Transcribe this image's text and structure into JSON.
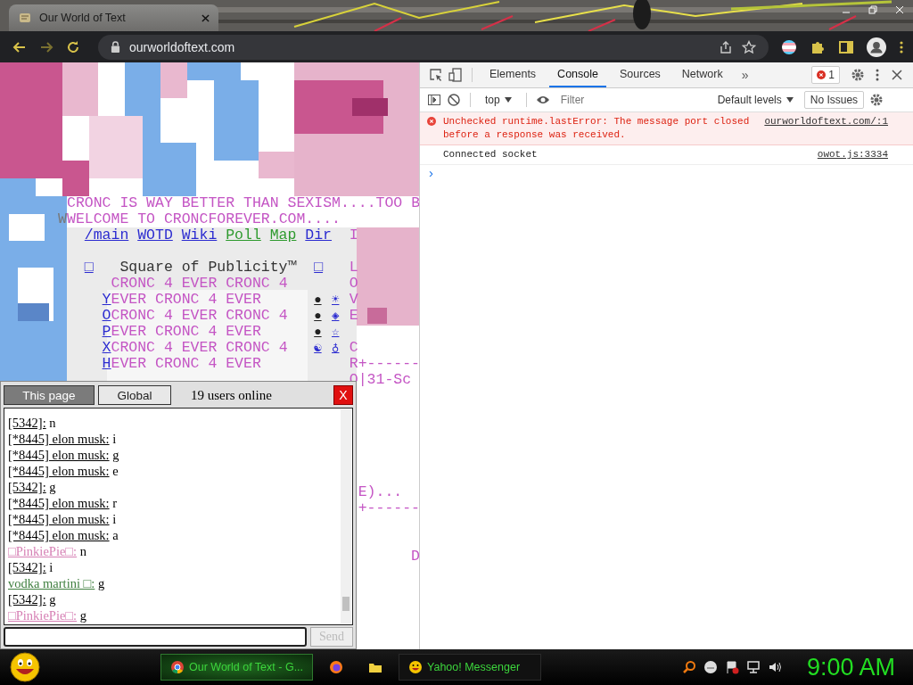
{
  "browser": {
    "tab_title": "Our World of Text",
    "url": "ourworldoftext.com"
  },
  "canvas": {
    "banner": "CRONC IS WAY BETTER THAN SEXISM....TOO B",
    "welcome_mark": "W",
    "welcome": "WELCOME TO CRONCFOREVER.COM....",
    "nav_links": [
      {
        "text": "/main",
        "color": "#2b2bd0"
      },
      {
        "text": "WOTD",
        "color": "#2b2bd0"
      },
      {
        "text": "Wiki",
        "color": "#2b2bd0"
      },
      {
        "text": "Poll",
        "color": "#2e9a2e"
      },
      {
        "text": "Map",
        "color": "#2e9a2e"
      },
      {
        "text": "Dir",
        "color": "#2b2bd0"
      }
    ],
    "title_marks": [
      "□",
      "□"
    ],
    "publicity_title": "Square of Publicity™",
    "rows": [
      {
        "letter": "",
        "text": "CRONC 4 EVER CRONC 4",
        "icons": []
      },
      {
        "letter": "Y",
        "text": "EVER CRONC 4 EVER",
        "icons": [
          "●",
          "☀"
        ]
      },
      {
        "letter": "O",
        "text": "CRONC 4 EVER CRONC 4",
        "icons": [
          "●",
          "◈"
        ]
      },
      {
        "letter": "P",
        "text": "EVER CRONC 4 EVER",
        "icons": [
          "●",
          "☆"
        ]
      },
      {
        "letter": "X",
        "text": "CRONC 4 EVER CRONC 4",
        "icons": [
          "☯",
          "♁"
        ]
      },
      {
        "letter": "H",
        "text": "EVER CRONC 4 EVER",
        "icons": []
      }
    ],
    "right_column": [
      "I",
      "L",
      "O",
      "V",
      "E",
      "C",
      "R+------",
      "O|31-Sc"
    ],
    "fragments": [
      "E)...",
      "+------",
      "D"
    ]
  },
  "chat": {
    "tabs": [
      {
        "label": "This page",
        "selected": true
      },
      {
        "label": "Global",
        "selected": false
      }
    ],
    "online": "19 users online",
    "close": "X",
    "messages": [
      {
        "name": "[5342]:",
        "text": "n",
        "color": "#000000"
      },
      {
        "name": "[*8445] elon musk:",
        "text": "i",
        "color": "#000000"
      },
      {
        "name": "[*8445] elon musk:",
        "text": "g",
        "color": "#000000"
      },
      {
        "name": "[*8445] elon musk:",
        "text": "e",
        "color": "#000000"
      },
      {
        "name": "[5342]:",
        "text": "g",
        "color": "#000000"
      },
      {
        "name": "[*8445] elon musk:",
        "text": "r",
        "color": "#000000"
      },
      {
        "name": "[*8445] elon musk:",
        "text": "i",
        "color": "#000000"
      },
      {
        "name": "[*8445] elon musk:",
        "text": "a",
        "color": "#000000"
      },
      {
        "name": "□PinkiePie□:",
        "text": "n",
        "color": "#d67fb4"
      },
      {
        "name": "[5342]:",
        "text": "i",
        "color": "#000000"
      },
      {
        "name": "vodka martini □:",
        "text": "g",
        "color": "#3f7f3f"
      },
      {
        "name": "[5342]:",
        "text": "g",
        "color": "#000000"
      },
      {
        "name": "□PinkiePie□:",
        "text": "g",
        "color": "#d67fb4"
      }
    ],
    "send": {
      "label": "Send",
      "disabled": true
    }
  },
  "devtools": {
    "tabs": [
      {
        "label": "Elements",
        "selected": false
      },
      {
        "label": "Console",
        "selected": true
      },
      {
        "label": "Sources",
        "selected": false
      },
      {
        "label": "Network",
        "selected": false
      }
    ],
    "more": "»",
    "error_count": "1",
    "context": "top",
    "filter_placeholder": "Filter",
    "levels": "Default levels",
    "issues": "No Issues",
    "messages": [
      {
        "kind": "error",
        "text": "Unchecked runtime.lastError: The message port closed before a response was received.",
        "source": "ourworldoftext.com/:1"
      },
      {
        "kind": "log",
        "text": "Connected socket",
        "source": "owot.js:3334"
      }
    ],
    "prompt": "›"
  },
  "taskbar": {
    "tasks": [
      {
        "kind": "window",
        "label": "Our World of Text - G...",
        "selected": true
      },
      {
        "kind": "icon",
        "selected": false
      },
      {
        "kind": "icon",
        "selected": false
      },
      {
        "kind": "window",
        "label": "Yahoo! Messenger",
        "selected": false
      }
    ],
    "clock": "9:00 AM"
  }
}
